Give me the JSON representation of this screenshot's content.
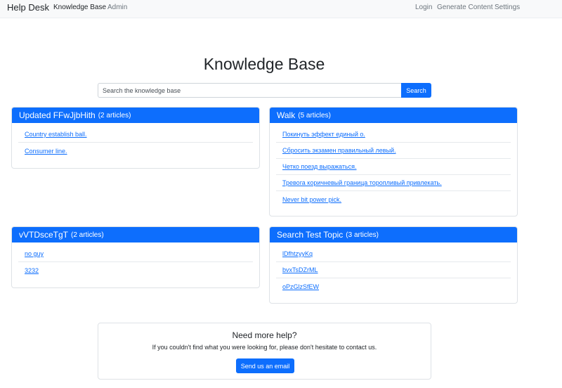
{
  "navbar": {
    "brand": "Help Desk",
    "left_links": [
      "Knowledge Base",
      "Admin"
    ],
    "right_links": [
      "Login",
      "Generate Content",
      "Settings"
    ]
  },
  "page": {
    "title": "Knowledge Base"
  },
  "search": {
    "placeholder": "Search the knowledge base",
    "button_label": "Search"
  },
  "topics": [
    {
      "title": "Updated FFwJjbHith",
      "count_text": "(2 articles)",
      "articles": [
        "Country establish ball.",
        "Consumer line."
      ]
    },
    {
      "title": "Walk",
      "count_text": "(5 articles)",
      "articles": [
        "Покинуть эффект единый о.",
        "Сбросить экзамен правильный левый.",
        "Четко поезд выражаться.",
        "Тревога коричневый граница торопливый привлекать.",
        "Never bit power pick."
      ]
    },
    {
      "title": "vVTDsceTgT",
      "count_text": "(2 articles)",
      "articles": [
        "no guy",
        "3232"
      ]
    },
    {
      "title": "Search Test Topic",
      "count_text": "(3 articles)",
      "articles": [
        "lDfhtzyyKq",
        "bvxTsDZrML",
        "oPzGlzSfEW"
      ]
    }
  ],
  "help": {
    "title": "Need more help?",
    "text": "If you couldn't find what you were looking for, please don't hesitate to contact us.",
    "button_label": "Send us an email"
  },
  "colors": {
    "primary": "#0d6efd",
    "navbar_bg": "#f8f9fa"
  }
}
